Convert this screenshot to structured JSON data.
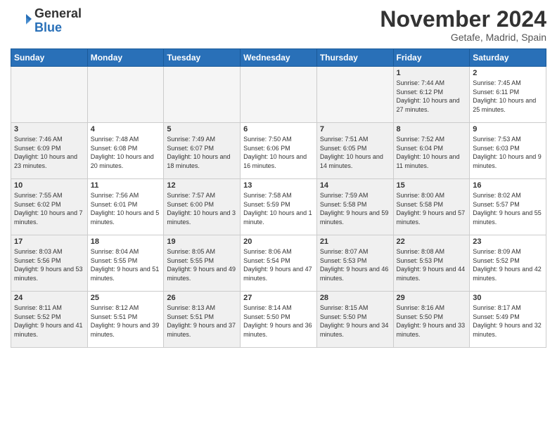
{
  "header": {
    "logo_line1": "General",
    "logo_line2": "Blue",
    "month": "November 2024",
    "location": "Getafe, Madrid, Spain"
  },
  "weekdays": [
    "Sunday",
    "Monday",
    "Tuesday",
    "Wednesday",
    "Thursday",
    "Friday",
    "Saturday"
  ],
  "weeks": [
    [
      {
        "day": "",
        "info": "",
        "empty": true
      },
      {
        "day": "",
        "info": "",
        "empty": true
      },
      {
        "day": "",
        "info": "",
        "empty": true
      },
      {
        "day": "",
        "info": "",
        "empty": true
      },
      {
        "day": "",
        "info": "",
        "empty": true
      },
      {
        "day": "1",
        "info": "Sunrise: 7:44 AM\nSunset: 6:12 PM\nDaylight: 10 hours and 27 minutes.",
        "shaded": true
      },
      {
        "day": "2",
        "info": "Sunrise: 7:45 AM\nSunset: 6:11 PM\nDaylight: 10 hours and 25 minutes."
      }
    ],
    [
      {
        "day": "3",
        "info": "Sunrise: 7:46 AM\nSunset: 6:09 PM\nDaylight: 10 hours and 23 minutes.",
        "shaded": true
      },
      {
        "day": "4",
        "info": "Sunrise: 7:48 AM\nSunset: 6:08 PM\nDaylight: 10 hours and 20 minutes."
      },
      {
        "day": "5",
        "info": "Sunrise: 7:49 AM\nSunset: 6:07 PM\nDaylight: 10 hours and 18 minutes.",
        "shaded": true
      },
      {
        "day": "6",
        "info": "Sunrise: 7:50 AM\nSunset: 6:06 PM\nDaylight: 10 hours and 16 minutes."
      },
      {
        "day": "7",
        "info": "Sunrise: 7:51 AM\nSunset: 6:05 PM\nDaylight: 10 hours and 14 minutes.",
        "shaded": true
      },
      {
        "day": "8",
        "info": "Sunrise: 7:52 AM\nSunset: 6:04 PM\nDaylight: 10 hours and 11 minutes.",
        "shaded": true
      },
      {
        "day": "9",
        "info": "Sunrise: 7:53 AM\nSunset: 6:03 PM\nDaylight: 10 hours and 9 minutes."
      }
    ],
    [
      {
        "day": "10",
        "info": "Sunrise: 7:55 AM\nSunset: 6:02 PM\nDaylight: 10 hours and 7 minutes.",
        "shaded": true
      },
      {
        "day": "11",
        "info": "Sunrise: 7:56 AM\nSunset: 6:01 PM\nDaylight: 10 hours and 5 minutes."
      },
      {
        "day": "12",
        "info": "Sunrise: 7:57 AM\nSunset: 6:00 PM\nDaylight: 10 hours and 3 minutes.",
        "shaded": true
      },
      {
        "day": "13",
        "info": "Sunrise: 7:58 AM\nSunset: 5:59 PM\nDaylight: 10 hours and 1 minute."
      },
      {
        "day": "14",
        "info": "Sunrise: 7:59 AM\nSunset: 5:58 PM\nDaylight: 9 hours and 59 minutes.",
        "shaded": true
      },
      {
        "day": "15",
        "info": "Sunrise: 8:00 AM\nSunset: 5:58 PM\nDaylight: 9 hours and 57 minutes.",
        "shaded": true
      },
      {
        "day": "16",
        "info": "Sunrise: 8:02 AM\nSunset: 5:57 PM\nDaylight: 9 hours and 55 minutes."
      }
    ],
    [
      {
        "day": "17",
        "info": "Sunrise: 8:03 AM\nSunset: 5:56 PM\nDaylight: 9 hours and 53 minutes.",
        "shaded": true
      },
      {
        "day": "18",
        "info": "Sunrise: 8:04 AM\nSunset: 5:55 PM\nDaylight: 9 hours and 51 minutes."
      },
      {
        "day": "19",
        "info": "Sunrise: 8:05 AM\nSunset: 5:55 PM\nDaylight: 9 hours and 49 minutes.",
        "shaded": true
      },
      {
        "day": "20",
        "info": "Sunrise: 8:06 AM\nSunset: 5:54 PM\nDaylight: 9 hours and 47 minutes."
      },
      {
        "day": "21",
        "info": "Sunrise: 8:07 AM\nSunset: 5:53 PM\nDaylight: 9 hours and 46 minutes.",
        "shaded": true
      },
      {
        "day": "22",
        "info": "Sunrise: 8:08 AM\nSunset: 5:53 PM\nDaylight: 9 hours and 44 minutes.",
        "shaded": true
      },
      {
        "day": "23",
        "info": "Sunrise: 8:09 AM\nSunset: 5:52 PM\nDaylight: 9 hours and 42 minutes."
      }
    ],
    [
      {
        "day": "24",
        "info": "Sunrise: 8:11 AM\nSunset: 5:52 PM\nDaylight: 9 hours and 41 minutes.",
        "shaded": true
      },
      {
        "day": "25",
        "info": "Sunrise: 8:12 AM\nSunset: 5:51 PM\nDaylight: 9 hours and 39 minutes."
      },
      {
        "day": "26",
        "info": "Sunrise: 8:13 AM\nSunset: 5:51 PM\nDaylight: 9 hours and 37 minutes.",
        "shaded": true
      },
      {
        "day": "27",
        "info": "Sunrise: 8:14 AM\nSunset: 5:50 PM\nDaylight: 9 hours and 36 minutes."
      },
      {
        "day": "28",
        "info": "Sunrise: 8:15 AM\nSunset: 5:50 PM\nDaylight: 9 hours and 34 minutes.",
        "shaded": true
      },
      {
        "day": "29",
        "info": "Sunrise: 8:16 AM\nSunset: 5:50 PM\nDaylight: 9 hours and 33 minutes.",
        "shaded": true
      },
      {
        "day": "30",
        "info": "Sunrise: 8:17 AM\nSunset: 5:49 PM\nDaylight: 9 hours and 32 minutes."
      }
    ]
  ]
}
